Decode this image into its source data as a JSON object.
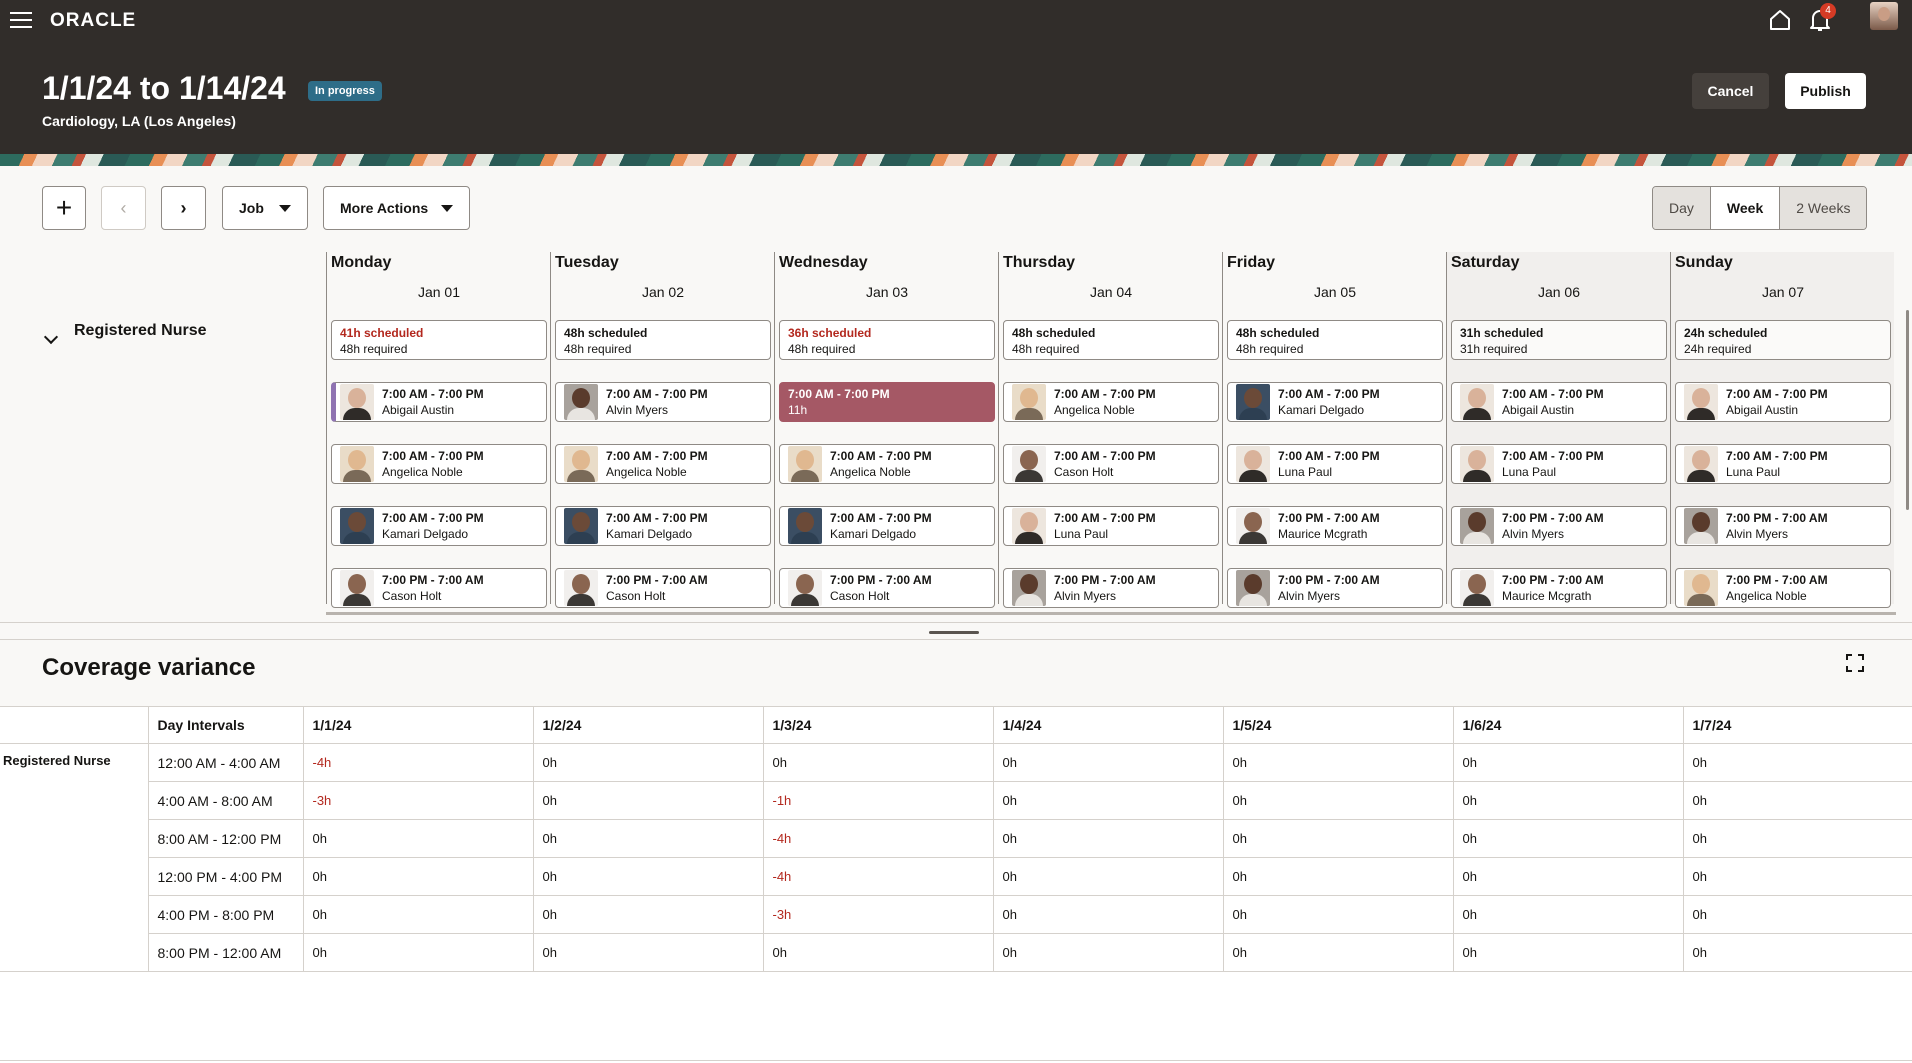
{
  "header": {
    "logo": "ORACLE",
    "title": "1/1/24 to 1/14/24",
    "status": "In progress",
    "subtitle": "Cardiology, LA (Los Angeles)",
    "notification_count": "4",
    "cancel_label": "Cancel",
    "publish_label": "Publish"
  },
  "toolbar": {
    "add_icon": "+",
    "prev_icon": "‹",
    "next_icon": "›",
    "job_label": "Job",
    "more_actions_label": "More Actions",
    "views": [
      "Day",
      "Week",
      "2 Weeks"
    ],
    "active_view": "Week"
  },
  "schedule": {
    "role": "Registered Nurse",
    "days": [
      {
        "name": "Monday",
        "date": "Jan 01",
        "scheduled": "41h scheduled",
        "required": "48h required",
        "short": true,
        "weekend": false,
        "shifts": [
          {
            "time": "7:00 AM - 7:00 PM",
            "person": "Abigail Austin",
            "photo": "a",
            "accent": "purple"
          },
          {
            "time": "7:00 AM - 7:00 PM",
            "person": "Angelica Noble",
            "photo": "b"
          },
          {
            "time": "7:00 AM - 7:00 PM",
            "person": "Kamari Delgado",
            "photo": "c"
          },
          {
            "time": "7:00 PM - 7:00 AM",
            "person": "Cason Holt",
            "photo": "d"
          }
        ]
      },
      {
        "name": "Tuesday",
        "date": "Jan 02",
        "scheduled": "48h scheduled",
        "required": "48h required",
        "short": false,
        "weekend": false,
        "shifts": [
          {
            "time": "7:00 AM - 7:00 PM",
            "person": "Alvin Myers",
            "photo": "e"
          },
          {
            "time": "7:00 AM - 7:00 PM",
            "person": "Angelica Noble",
            "photo": "b"
          },
          {
            "time": "7:00 AM - 7:00 PM",
            "person": "Kamari Delgado",
            "photo": "c"
          },
          {
            "time": "7:00 PM - 7:00 AM",
            "person": "Cason Holt",
            "photo": "d"
          }
        ]
      },
      {
        "name": "Wednesday",
        "date": "Jan 03",
        "scheduled": "36h scheduled",
        "required": "48h required",
        "short": true,
        "weekend": false,
        "shifts": [
          {
            "time": "7:00 AM - 7:00 PM",
            "person": "11h",
            "open": true
          },
          {
            "time": "7:00 AM - 7:00 PM",
            "person": "Angelica Noble",
            "photo": "b"
          },
          {
            "time": "7:00 AM - 7:00 PM",
            "person": "Kamari Delgado",
            "photo": "c"
          },
          {
            "time": "7:00 PM - 7:00 AM",
            "person": "Cason Holt",
            "photo": "d"
          }
        ]
      },
      {
        "name": "Thursday",
        "date": "Jan 04",
        "scheduled": "48h scheduled",
        "required": "48h required",
        "short": false,
        "weekend": false,
        "shifts": [
          {
            "time": "7:00 AM - 7:00 PM",
            "person": "Angelica Noble",
            "photo": "b"
          },
          {
            "time": "7:00 AM - 7:00 PM",
            "person": "Cason Holt",
            "photo": "d"
          },
          {
            "time": "7:00 AM - 7:00 PM",
            "person": "Luna Paul",
            "photo": "a"
          },
          {
            "time": "7:00 PM - 7:00 AM",
            "person": "Alvin Myers",
            "photo": "e"
          }
        ]
      },
      {
        "name": "Friday",
        "date": "Jan 05",
        "scheduled": "48h scheduled",
        "required": "48h required",
        "short": false,
        "weekend": false,
        "shifts": [
          {
            "time": "7:00 AM - 7:00 PM",
            "person": "Kamari Delgado",
            "photo": "c"
          },
          {
            "time": "7:00 AM - 7:00 PM",
            "person": "Luna Paul",
            "photo": "a"
          },
          {
            "time": "7:00 PM - 7:00 AM",
            "person": "Maurice Mcgrath",
            "photo": "d"
          },
          {
            "time": "7:00 PM - 7:00 AM",
            "person": "Alvin Myers",
            "photo": "e"
          }
        ]
      },
      {
        "name": "Saturday",
        "date": "Jan 06",
        "scheduled": "31h scheduled",
        "required": "31h required",
        "short": false,
        "weekend": true,
        "shifts": [
          {
            "time": "7:00 AM - 7:00 PM",
            "person": "Abigail Austin",
            "photo": "a"
          },
          {
            "time": "7:00 AM - 7:00 PM",
            "person": "Luna Paul",
            "photo": "a"
          },
          {
            "time": "7:00 PM - 7:00 AM",
            "person": "Alvin Myers",
            "photo": "e"
          },
          {
            "time": "7:00 PM - 7:00 AM",
            "person": "Maurice Mcgrath",
            "photo": "d"
          }
        ]
      },
      {
        "name": "Sunday",
        "date": "Jan 07",
        "scheduled": "24h scheduled",
        "required": "24h required",
        "short": false,
        "weekend": true,
        "shifts": [
          {
            "time": "7:00 AM - 7:00 PM",
            "person": "Abigail Austin",
            "photo": "a"
          },
          {
            "time": "7:00 AM - 7:00 PM",
            "person": "Luna Paul",
            "photo": "a"
          },
          {
            "time": "7:00 PM - 7:00 AM",
            "person": "Alvin Myers",
            "photo": "e"
          },
          {
            "time": "7:00 PM - 7:00 AM",
            "person": "Angelica Noble",
            "photo": "b"
          }
        ]
      }
    ]
  },
  "coverage": {
    "title": "Coverage variance",
    "interval_header": "Day Intervals",
    "role": "Registered Nurse",
    "dates": [
      "1/1/24",
      "1/2/24",
      "1/3/24",
      "1/4/24",
      "1/5/24",
      "1/6/24",
      "1/7/24"
    ],
    "rows": [
      {
        "interval": "12:00 AM - 4:00 AM",
        "values": [
          "-4h",
          "0h",
          "0h",
          "0h",
          "0h",
          "0h",
          "0h"
        ]
      },
      {
        "interval": "4:00 AM - 8:00 AM",
        "values": [
          "-3h",
          "0h",
          "-1h",
          "0h",
          "0h",
          "0h",
          "0h"
        ]
      },
      {
        "interval": "8:00 AM - 12:00 PM",
        "values": [
          "0h",
          "0h",
          "-4h",
          "0h",
          "0h",
          "0h",
          "0h"
        ]
      },
      {
        "interval": "12:00 PM - 4:00 PM",
        "values": [
          "0h",
          "0h",
          "-4h",
          "0h",
          "0h",
          "0h",
          "0h"
        ]
      },
      {
        "interval": "4:00 PM - 8:00 PM",
        "values": [
          "0h",
          "0h",
          "-3h",
          "0h",
          "0h",
          "0h",
          "0h"
        ]
      },
      {
        "interval": "8:00 PM - 12:00 AM",
        "values": [
          "0h",
          "0h",
          "0h",
          "0h",
          "0h",
          "0h",
          "0h"
        ]
      }
    ]
  },
  "colors": {
    "header_bg": "#312d2a",
    "status_badge": "#2e6d88",
    "shortage_red": "#b3281e",
    "open_shift": "#a55865",
    "accent_purple": "#8f73b2"
  },
  "icons": [
    "hamburger-menu-icon",
    "home-icon",
    "bell-icon",
    "user-avatar-icon",
    "plus-icon",
    "chevron-left-icon",
    "chevron-right-icon",
    "caret-down-icon",
    "chevron-down-icon",
    "expand-icon"
  ]
}
